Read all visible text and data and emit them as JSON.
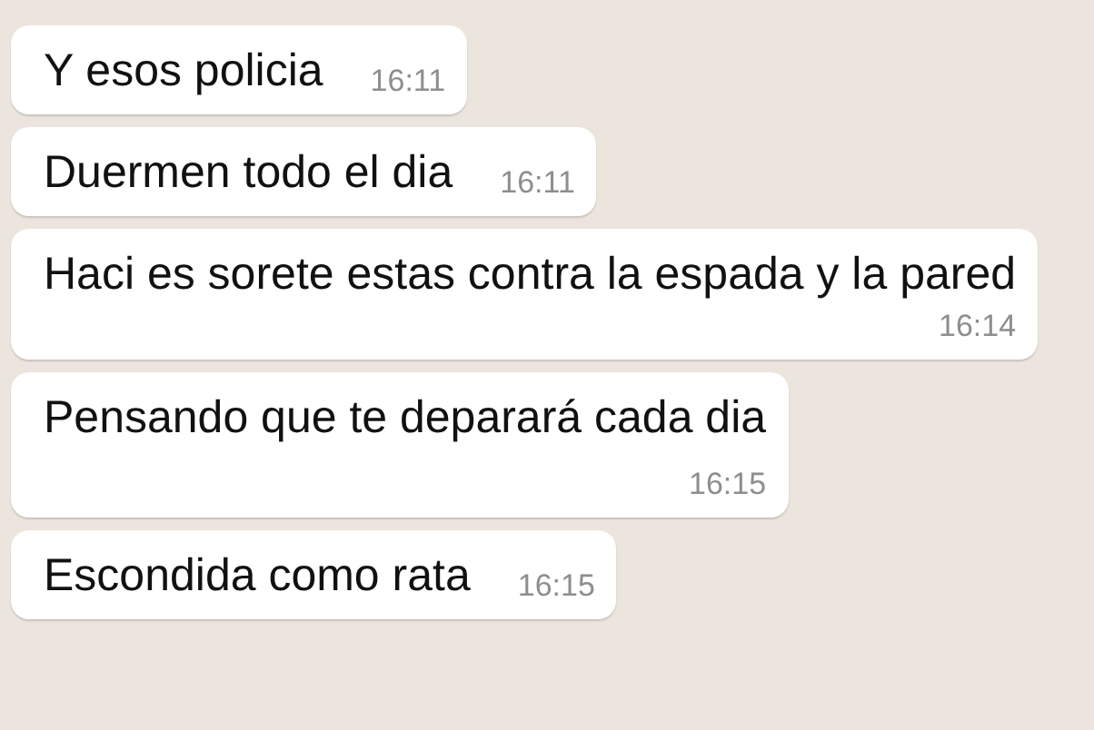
{
  "messages": [
    {
      "text": "Y esos policia",
      "time": "16:11",
      "kind": "inline"
    },
    {
      "text": "Duermen todo el dia",
      "time": "16:11",
      "kind": "inline"
    },
    {
      "text": "Haci es sorete estas contra la espada y la pared",
      "time": "16:14",
      "kind": "below"
    },
    {
      "text": "Pensando que te deparará cada dia",
      "time": "16:15",
      "kind": "below"
    },
    {
      "text": "Escondida como rata",
      "time": "16:15",
      "kind": "inline"
    }
  ]
}
